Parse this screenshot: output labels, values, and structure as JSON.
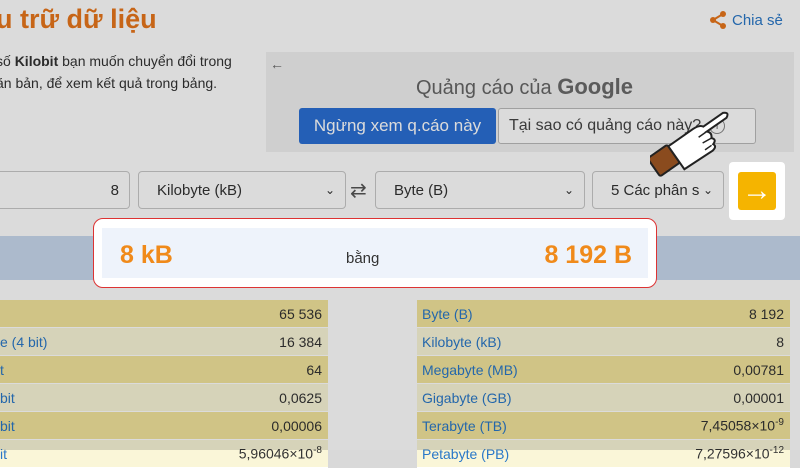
{
  "header": {
    "title": "u trữ dữ liệu",
    "share_label": "Chia sẻ"
  },
  "intro": {
    "line_prefix": "số ",
    "bold_word": "Kilobit",
    "line_suffix": " bạn muốn chuyển đổi trong",
    "line2": "ăn bản, để xem kết quả trong bảng.",
    "back_icon": "←"
  },
  "ad": {
    "label": "Quảng cáo của",
    "brand": "Google",
    "stop_button": "Ngừng xem q.cáo này",
    "why_button": "Tại sao có quảng cáo này?",
    "info_icon": "i"
  },
  "converter": {
    "input_value": "8",
    "from_unit": "Kilobyte (kB)",
    "to_unit": "Byte (B)",
    "precision": "5 Các phân s",
    "swap_icon": "⇄",
    "go_icon": "→"
  },
  "result": {
    "left": "8 kB",
    "middle": "bằng",
    "right": "8 192 B"
  },
  "left_table": [
    {
      "label": "",
      "value": "65 536"
    },
    {
      "label": "e (4 bit)",
      "value": "16 384"
    },
    {
      "label": "t",
      "value": "64"
    },
    {
      "label": "bit",
      "value": "0,0625"
    },
    {
      "label": "bit",
      "value": "0,00006"
    },
    {
      "label": "it",
      "value": "5,96046×10",
      "sup": "-8"
    }
  ],
  "right_table": [
    {
      "label": "Byte (B)",
      "value": "8 192"
    },
    {
      "label": "Kilobyte (kB)",
      "value": "8"
    },
    {
      "label": "Megabyte (MB)",
      "value": "0,00781"
    },
    {
      "label": "Gigabyte (GB)",
      "value": "0,00001"
    },
    {
      "label": "Terabyte (TB)",
      "value": "7,45058×10",
      "sup": "-9"
    },
    {
      "label": "Petabyte (PB)",
      "value": "7,27596×10",
      "sup": "-12"
    }
  ],
  "colors": {
    "accent": "#e8761b",
    "link": "#2a78c8",
    "highlight": "#f5b400",
    "row": "#f3e59c"
  }
}
